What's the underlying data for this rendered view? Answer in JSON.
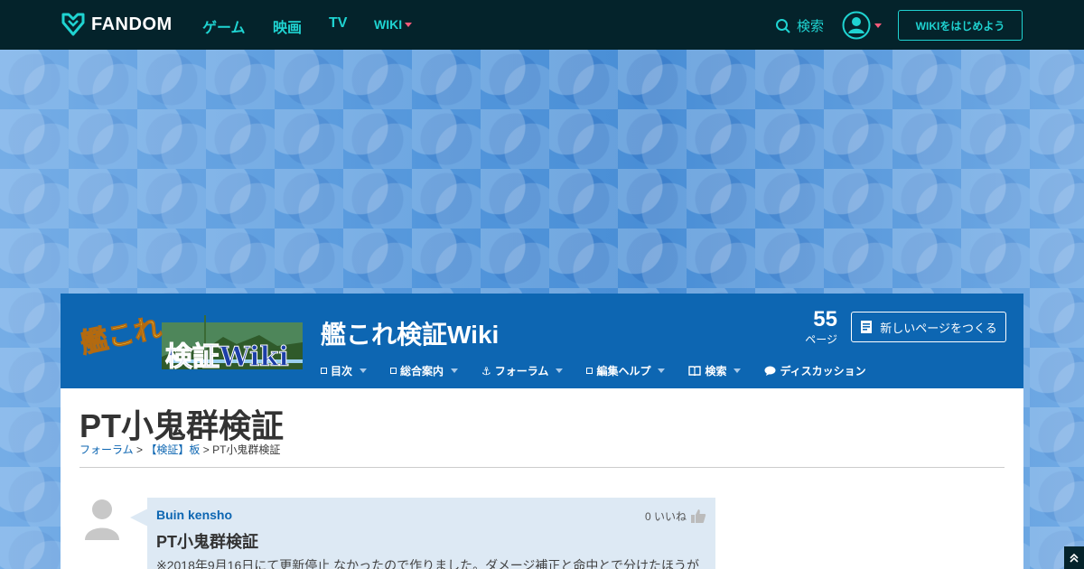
{
  "topnav": {
    "brand": "FANDOM",
    "links": [
      "ゲーム",
      "映画",
      "TV"
    ],
    "wiki_label": "WIKI",
    "search_label": "検索",
    "start_wiki_label": "WIKIをはじめよう"
  },
  "wiki": {
    "title": "艦これ検証Wiki",
    "logo_text_top": "艦これ",
    "logo_text_bottom": "検証Wiki",
    "page_count": "55",
    "page_count_label": "ページ",
    "new_page_label": "新しいページをつくる",
    "nav": [
      {
        "label": "目次",
        "icon": "box-icon",
        "caret": true
      },
      {
        "label": "総合案内",
        "icon": "box-icon",
        "caret": true
      },
      {
        "label": "フォーラム",
        "icon": "anchor-icon",
        "caret": true
      },
      {
        "label": "編集ヘルプ",
        "icon": "box-icon",
        "caret": true
      },
      {
        "label": "検索",
        "icon": "book-icon",
        "caret": true
      },
      {
        "label": "ディスカッション",
        "icon": "speech-bubble-icon",
        "caret": false
      }
    ]
  },
  "page": {
    "title": "PT小鬼群検証",
    "breadcrumb": {
      "forum": "フォーラム",
      "board": "【検証】板",
      "current": "PT小鬼群検証",
      "sep": ">"
    }
  },
  "post": {
    "author": "Buin kensho",
    "likes": "0 いいね",
    "title": "PT小鬼群検証",
    "body": "※2018年9月16日にて更新停止 なかったので作りました。ダメージ補正と命中とで分けたほうが"
  },
  "colors": {
    "topnav_bg": "#04232b",
    "accent": "#1fd3d1",
    "wiki_header": "#0d66b2",
    "post_bg": "#dde9f4"
  }
}
